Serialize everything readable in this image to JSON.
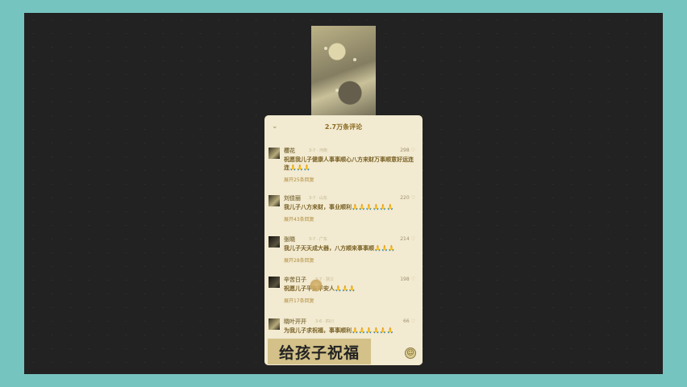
{
  "overlay": {
    "caption": "给孩子祝福"
  },
  "panel": {
    "title": "2.7万条评论",
    "comments": [
      {
        "user": "樱花",
        "meta": "3-7 · 河南",
        "text": "祝愿我儿子健康人事事顺心八方来财万事顺意好运连连🙏🙏🙏",
        "replies": "展开25条回复",
        "likes": "298"
      },
      {
        "user": "刘佳丽",
        "meta": "3-7 · 山东",
        "text": "我儿子八方来财，事业顺利🙏🙏🙏🙏🙏🙏",
        "replies": "展开43条回复",
        "likes": "220"
      },
      {
        "user": "张晓",
        "meta": "3-7 · 广东",
        "text": "我儿子天天成大器，八方顺来事事顺🙏🙏🙏",
        "replies": "展开28条回复",
        "likes": "214"
      },
      {
        "user": "辛苦日子",
        "meta": "3-7 · 浙江",
        "text": "祝愿儿子平安平安人🙏🙏🙏",
        "replies": "展开17条回复",
        "likes": "198"
      },
      {
        "user": "晓叶开开",
        "meta": "3-6 · 四川",
        "text": "为我儿子求祝福，事事顺利🙏🙏🙏🙏🙏🙏",
        "replies": "",
        "likes": "66"
      }
    ]
  },
  "icons": {
    "collapse": "chevron-down-icon",
    "heart": "heart-icon",
    "emoji": "emoji-icon",
    "reaction": "smile-icon"
  }
}
